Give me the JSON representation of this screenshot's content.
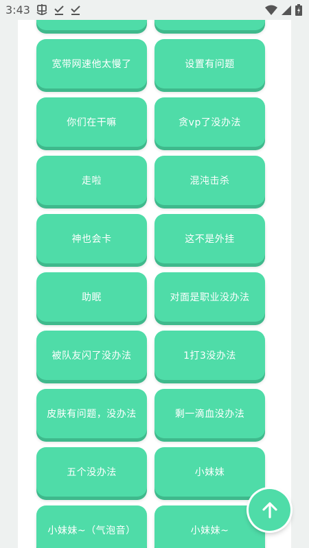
{
  "status_bar": {
    "time": "3:43"
  },
  "buttons": [
    [
      "",
      ""
    ],
    [
      "宽带网速他太慢了",
      "设置有问题"
    ],
    [
      "你们在干嘛",
      "贪vp了没办法"
    ],
    [
      "走啦",
      "混沌击杀"
    ],
    [
      "神也会卡",
      "这不是外挂"
    ],
    [
      "助眠",
      "对面是职业没办法"
    ],
    [
      "被队友闪了没办法",
      "1打3没办法"
    ],
    [
      "皮肤有问题，没办法",
      "剩一滴血没办法"
    ],
    [
      "五个没办法",
      "小妹妹"
    ],
    [
      "小妹妹~（气泡音）",
      "小妹妹~"
    ]
  ],
  "colors": {
    "button": "#4fdca8",
    "button_shadow": "#3fb98c",
    "page_bg": "#eef1f0",
    "panel_bg": "#ffffff"
  },
  "fab": {
    "icon": "arrow-up-icon"
  }
}
